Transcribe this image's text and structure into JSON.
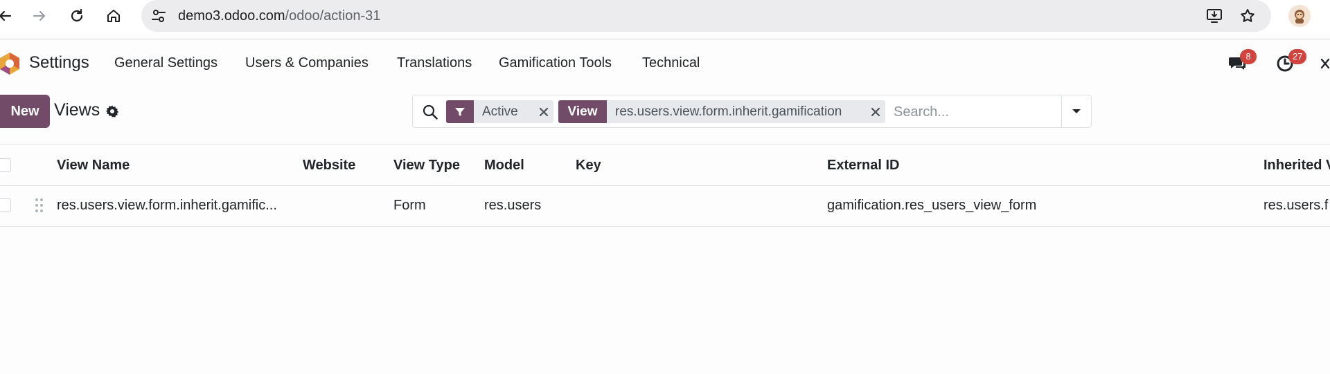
{
  "browser": {
    "url_host": "demo3.odoo.com",
    "url_path": "/odoo/action-31"
  },
  "navbar": {
    "app_name": "Settings",
    "menu": [
      {
        "label": "General Settings"
      },
      {
        "label": "Users & Companies"
      },
      {
        "label": "Translations"
      },
      {
        "label": "Gamification Tools"
      },
      {
        "label": "Technical"
      }
    ],
    "messages_count": "8",
    "activities_count": "27"
  },
  "control_panel": {
    "new_label": "New",
    "breadcrumb": "Views"
  },
  "search": {
    "facets": [
      {
        "value": "Active",
        "icon": "filter-icon"
      },
      {
        "label": "View",
        "value": "res.users.view.form.inherit.gamification"
      }
    ],
    "placeholder": "Search..."
  },
  "table": {
    "columns": [
      "View Name",
      "Website",
      "View Type",
      "Model",
      "Key",
      "External ID",
      "Inherited V"
    ],
    "rows": [
      {
        "view_name": "res.users.view.form.inherit.gamific...",
        "website": "",
        "view_type": "Form",
        "model": "res.users",
        "key": "",
        "external_id": "gamification.res_users_view_form",
        "inherited": "res.users.f"
      }
    ]
  },
  "colors": {
    "brand": "#714b67",
    "badge": "#d0443d",
    "url_pill": "#ececee"
  }
}
